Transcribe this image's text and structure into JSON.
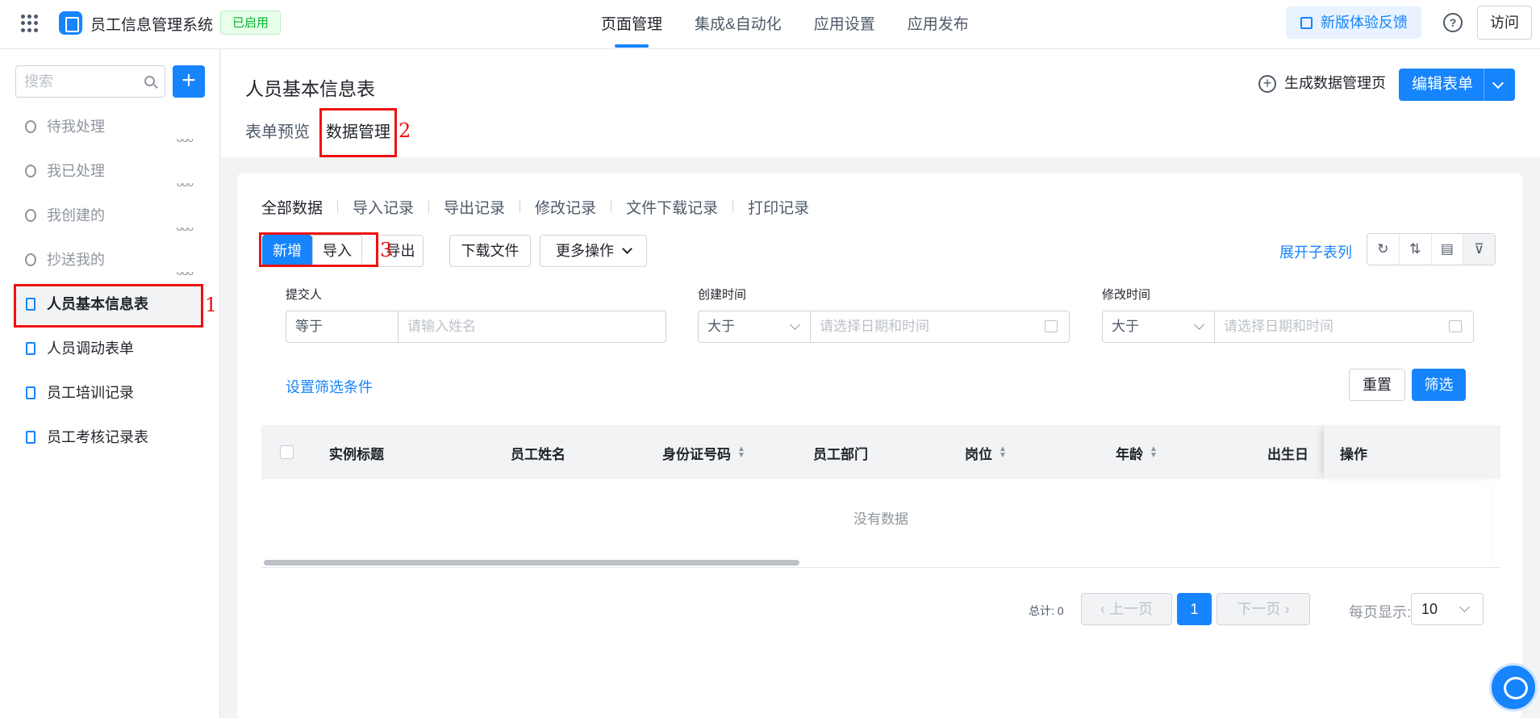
{
  "header": {
    "app_name": "员工信息管理系统",
    "status_badge": "已启用",
    "nav_tabs": [
      "页面管理",
      "集成&自动化",
      "应用设置",
      "应用发布"
    ],
    "feedback": "新版体验反馈",
    "help": "?",
    "visit": "访问"
  },
  "sidebar": {
    "search_placeholder": "搜索",
    "add": "+",
    "items": [
      {
        "label": "待我处理"
      },
      {
        "label": "我已处理"
      },
      {
        "label": "我创建的"
      },
      {
        "label": "抄送我的"
      },
      {
        "label": "人员基本信息表"
      },
      {
        "label": "人员调动表单"
      },
      {
        "label": "员工培训记录"
      },
      {
        "label": "员工考核记录表"
      }
    ]
  },
  "page": {
    "title": "人员基本信息表",
    "tabs": [
      "表单预览",
      "数据管理"
    ],
    "generate": "生成数据管理页",
    "edit": "编辑表单"
  },
  "data_tabs": [
    "全部数据",
    "导入记录",
    "导出记录",
    "修改记录",
    "文件下载记录",
    "打印记录"
  ],
  "toolbar": {
    "add": "新增",
    "import": "导入",
    "export": "导出",
    "download": "下载文件",
    "more": "更多操作",
    "expand": "展开子表列"
  },
  "filters": {
    "submitter": {
      "label": "提交人",
      "op": "等于",
      "placeholder": "请输入姓名"
    },
    "created": {
      "label": "创建时间",
      "op": "大于",
      "placeholder": "请选择日期和时间"
    },
    "modified": {
      "label": "修改时间",
      "op": "大于",
      "placeholder": "请选择日期和时间"
    },
    "set_conditions": "设置筛选条件",
    "reset": "重置",
    "apply": "筛选"
  },
  "table": {
    "columns": [
      "实例标题",
      "员工姓名",
      "身份证号码",
      "员工部门",
      "岗位",
      "年龄",
      "出生日",
      "操作"
    ],
    "empty": "没有数据"
  },
  "pagination": {
    "total": "总计: 0",
    "prev": "上一页",
    "current": "1",
    "next": "下一页",
    "per_page_label": "每页显示:",
    "per_page": "10"
  },
  "annotations": [
    "1",
    "2",
    "3"
  ],
  "colors": {
    "accent": "#1684fc",
    "annotation": "#ee1111"
  }
}
